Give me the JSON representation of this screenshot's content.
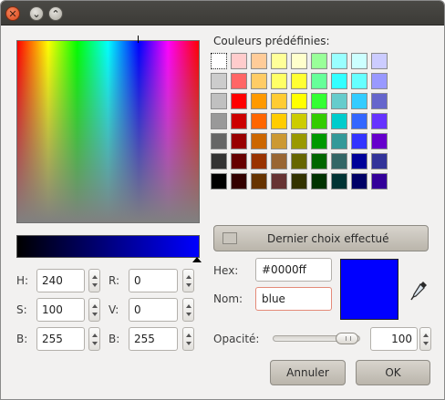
{
  "window": {
    "buttons": [
      {
        "name": "close-window-button",
        "icon": "close-icon",
        "glyph": "✕"
      },
      {
        "name": "minimize-window-button",
        "icon": "minimize-icon",
        "glyph": "⌄"
      },
      {
        "name": "maximize-window-button",
        "icon": "maximize-icon",
        "glyph": "⌃"
      }
    ]
  },
  "picker": {
    "hue_marker": "hue/saturation cursor",
    "value_gradient": {
      "from": "#000000",
      "to": "#0000ff"
    }
  },
  "hsv": {
    "h_label": "H:",
    "h_value": "240",
    "s_label": "S:",
    "s_value": "100",
    "b_label": "B:",
    "b_value": "255"
  },
  "rgb": {
    "r_label": "R:",
    "r_value": "0",
    "g_label": "V:",
    "g_value": "0",
    "b_label": "B:",
    "b_value": "255"
  },
  "palette": {
    "title": "Couleurs prédéfinies:",
    "selected_index": 0,
    "colors": [
      "#ffffff",
      "#ffcccc",
      "#ffcc99",
      "#ffff99",
      "#ffffcc",
      "#99ff99",
      "#99ffff",
      "#ccffff",
      "#ccccff",
      "#ffccff",
      "#cccccc",
      "#ff6666",
      "#ffcc66",
      "#ffff66",
      "#ffff33",
      "#66ff99",
      "#33ffff",
      "#66ffff",
      "#9999ff",
      "#ff99ff",
      "#c0c0c0",
      "#ff0000",
      "#ff9900",
      "#ffcc33",
      "#ffff00",
      "#33ff33",
      "#66cccc",
      "#33ccff",
      "#6666cc",
      "#cc66cc",
      "#999999",
      "#cc0000",
      "#ff6600",
      "#ffcc00",
      "#cccc00",
      "#33cc00",
      "#00cccc",
      "#3366ff",
      "#6633ff",
      "#cc33cc",
      "#666666",
      "#990000",
      "#cc6600",
      "#cc9933",
      "#999900",
      "#009900",
      "#339999",
      "#3333ff",
      "#6600cc",
      "#993399",
      "#333333",
      "#660000",
      "#993300",
      "#996633",
      "#666600",
      "#006600",
      "#336666",
      "#000099",
      "#333399",
      "#663366",
      "#000000",
      "#330000",
      "#663300",
      "#663333",
      "#333300",
      "#003300",
      "#003333",
      "#000066",
      "#330099",
      "#330033"
    ]
  },
  "last_choice": {
    "label": "Dernier choix effectué",
    "swatch_color": "#c9c5bd"
  },
  "hex": {
    "label": "Hex:",
    "value": "#0000ff"
  },
  "name": {
    "label": "Nom:",
    "value": "blue"
  },
  "preview": {
    "color": "#0000ff"
  },
  "eyedropper": {
    "icon": "eyedropper-icon"
  },
  "opacity": {
    "label": "Opacité:",
    "value": "100",
    "level": 1.0
  },
  "actions": {
    "cancel_label": "Annuler",
    "ok_label": "OK"
  }
}
